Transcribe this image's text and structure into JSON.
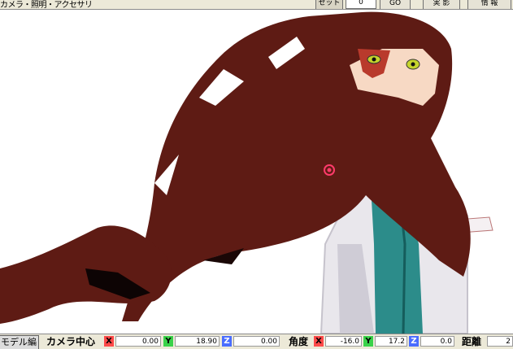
{
  "toolbar": {
    "title": "カメラ・照明・アクセサリ",
    "frame_label": "セット",
    "frame_value": "0",
    "go_label": "GO",
    "capture_label": "実 影",
    "info_label": "情 報"
  },
  "status": {
    "tab_label": "モデル編",
    "camera_center_label": "カメラ中心",
    "camera_x": "0.00",
    "camera_y": "18.90",
    "camera_z": "0.00",
    "angle_label": "角度",
    "angle_x": "-16.0",
    "angle_y": "17.2",
    "angle_z": "0.0",
    "distance_label": "距離",
    "distance_value": "2",
    "axis_x": "X",
    "axis_y": "Y",
    "axis_z": "Z"
  },
  "colors": {
    "hair": "#5e1b14",
    "skin": "#f7d9c4",
    "shirt": "#e9e7ec",
    "tie": "#2c8c8a"
  }
}
